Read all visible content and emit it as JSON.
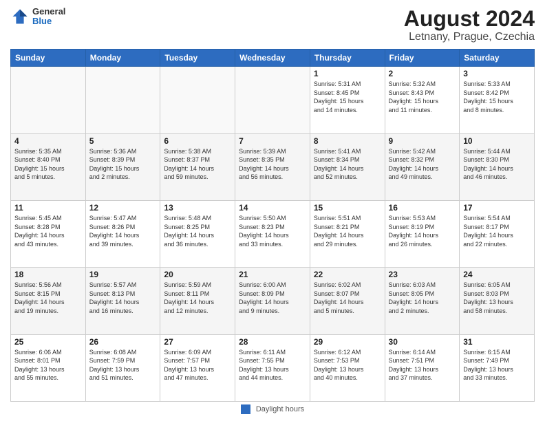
{
  "logo": {
    "general": "General",
    "blue": "Blue"
  },
  "title": "August 2024",
  "subtitle": "Letnany, Prague, Czechia",
  "days_header": [
    "Sunday",
    "Monday",
    "Tuesday",
    "Wednesday",
    "Thursday",
    "Friday",
    "Saturday"
  ],
  "footer_label": "Daylight hours",
  "weeks": [
    [
      {
        "day": "",
        "info": ""
      },
      {
        "day": "",
        "info": ""
      },
      {
        "day": "",
        "info": ""
      },
      {
        "day": "",
        "info": ""
      },
      {
        "day": "1",
        "info": "Sunrise: 5:31 AM\nSunset: 8:45 PM\nDaylight: 15 hours\nand 14 minutes."
      },
      {
        "day": "2",
        "info": "Sunrise: 5:32 AM\nSunset: 8:43 PM\nDaylight: 15 hours\nand 11 minutes."
      },
      {
        "day": "3",
        "info": "Sunrise: 5:33 AM\nSunset: 8:42 PM\nDaylight: 15 hours\nand 8 minutes."
      }
    ],
    [
      {
        "day": "4",
        "info": "Sunrise: 5:35 AM\nSunset: 8:40 PM\nDaylight: 15 hours\nand 5 minutes."
      },
      {
        "day": "5",
        "info": "Sunrise: 5:36 AM\nSunset: 8:39 PM\nDaylight: 15 hours\nand 2 minutes."
      },
      {
        "day": "6",
        "info": "Sunrise: 5:38 AM\nSunset: 8:37 PM\nDaylight: 14 hours\nand 59 minutes."
      },
      {
        "day": "7",
        "info": "Sunrise: 5:39 AM\nSunset: 8:35 PM\nDaylight: 14 hours\nand 56 minutes."
      },
      {
        "day": "8",
        "info": "Sunrise: 5:41 AM\nSunset: 8:34 PM\nDaylight: 14 hours\nand 52 minutes."
      },
      {
        "day": "9",
        "info": "Sunrise: 5:42 AM\nSunset: 8:32 PM\nDaylight: 14 hours\nand 49 minutes."
      },
      {
        "day": "10",
        "info": "Sunrise: 5:44 AM\nSunset: 8:30 PM\nDaylight: 14 hours\nand 46 minutes."
      }
    ],
    [
      {
        "day": "11",
        "info": "Sunrise: 5:45 AM\nSunset: 8:28 PM\nDaylight: 14 hours\nand 43 minutes."
      },
      {
        "day": "12",
        "info": "Sunrise: 5:47 AM\nSunset: 8:26 PM\nDaylight: 14 hours\nand 39 minutes."
      },
      {
        "day": "13",
        "info": "Sunrise: 5:48 AM\nSunset: 8:25 PM\nDaylight: 14 hours\nand 36 minutes."
      },
      {
        "day": "14",
        "info": "Sunrise: 5:50 AM\nSunset: 8:23 PM\nDaylight: 14 hours\nand 33 minutes."
      },
      {
        "day": "15",
        "info": "Sunrise: 5:51 AM\nSunset: 8:21 PM\nDaylight: 14 hours\nand 29 minutes."
      },
      {
        "day": "16",
        "info": "Sunrise: 5:53 AM\nSunset: 8:19 PM\nDaylight: 14 hours\nand 26 minutes."
      },
      {
        "day": "17",
        "info": "Sunrise: 5:54 AM\nSunset: 8:17 PM\nDaylight: 14 hours\nand 22 minutes."
      }
    ],
    [
      {
        "day": "18",
        "info": "Sunrise: 5:56 AM\nSunset: 8:15 PM\nDaylight: 14 hours\nand 19 minutes."
      },
      {
        "day": "19",
        "info": "Sunrise: 5:57 AM\nSunset: 8:13 PM\nDaylight: 14 hours\nand 16 minutes."
      },
      {
        "day": "20",
        "info": "Sunrise: 5:59 AM\nSunset: 8:11 PM\nDaylight: 14 hours\nand 12 minutes."
      },
      {
        "day": "21",
        "info": "Sunrise: 6:00 AM\nSunset: 8:09 PM\nDaylight: 14 hours\nand 9 minutes."
      },
      {
        "day": "22",
        "info": "Sunrise: 6:02 AM\nSunset: 8:07 PM\nDaylight: 14 hours\nand 5 minutes."
      },
      {
        "day": "23",
        "info": "Sunrise: 6:03 AM\nSunset: 8:05 PM\nDaylight: 14 hours\nand 2 minutes."
      },
      {
        "day": "24",
        "info": "Sunrise: 6:05 AM\nSunset: 8:03 PM\nDaylight: 13 hours\nand 58 minutes."
      }
    ],
    [
      {
        "day": "25",
        "info": "Sunrise: 6:06 AM\nSunset: 8:01 PM\nDaylight: 13 hours\nand 55 minutes."
      },
      {
        "day": "26",
        "info": "Sunrise: 6:08 AM\nSunset: 7:59 PM\nDaylight: 13 hours\nand 51 minutes."
      },
      {
        "day": "27",
        "info": "Sunrise: 6:09 AM\nSunset: 7:57 PM\nDaylight: 13 hours\nand 47 minutes."
      },
      {
        "day": "28",
        "info": "Sunrise: 6:11 AM\nSunset: 7:55 PM\nDaylight: 13 hours\nand 44 minutes."
      },
      {
        "day": "29",
        "info": "Sunrise: 6:12 AM\nSunset: 7:53 PM\nDaylight: 13 hours\nand 40 minutes."
      },
      {
        "day": "30",
        "info": "Sunrise: 6:14 AM\nSunset: 7:51 PM\nDaylight: 13 hours\nand 37 minutes."
      },
      {
        "day": "31",
        "info": "Sunrise: 6:15 AM\nSunset: 7:49 PM\nDaylight: 13 hours\nand 33 minutes."
      }
    ]
  ]
}
